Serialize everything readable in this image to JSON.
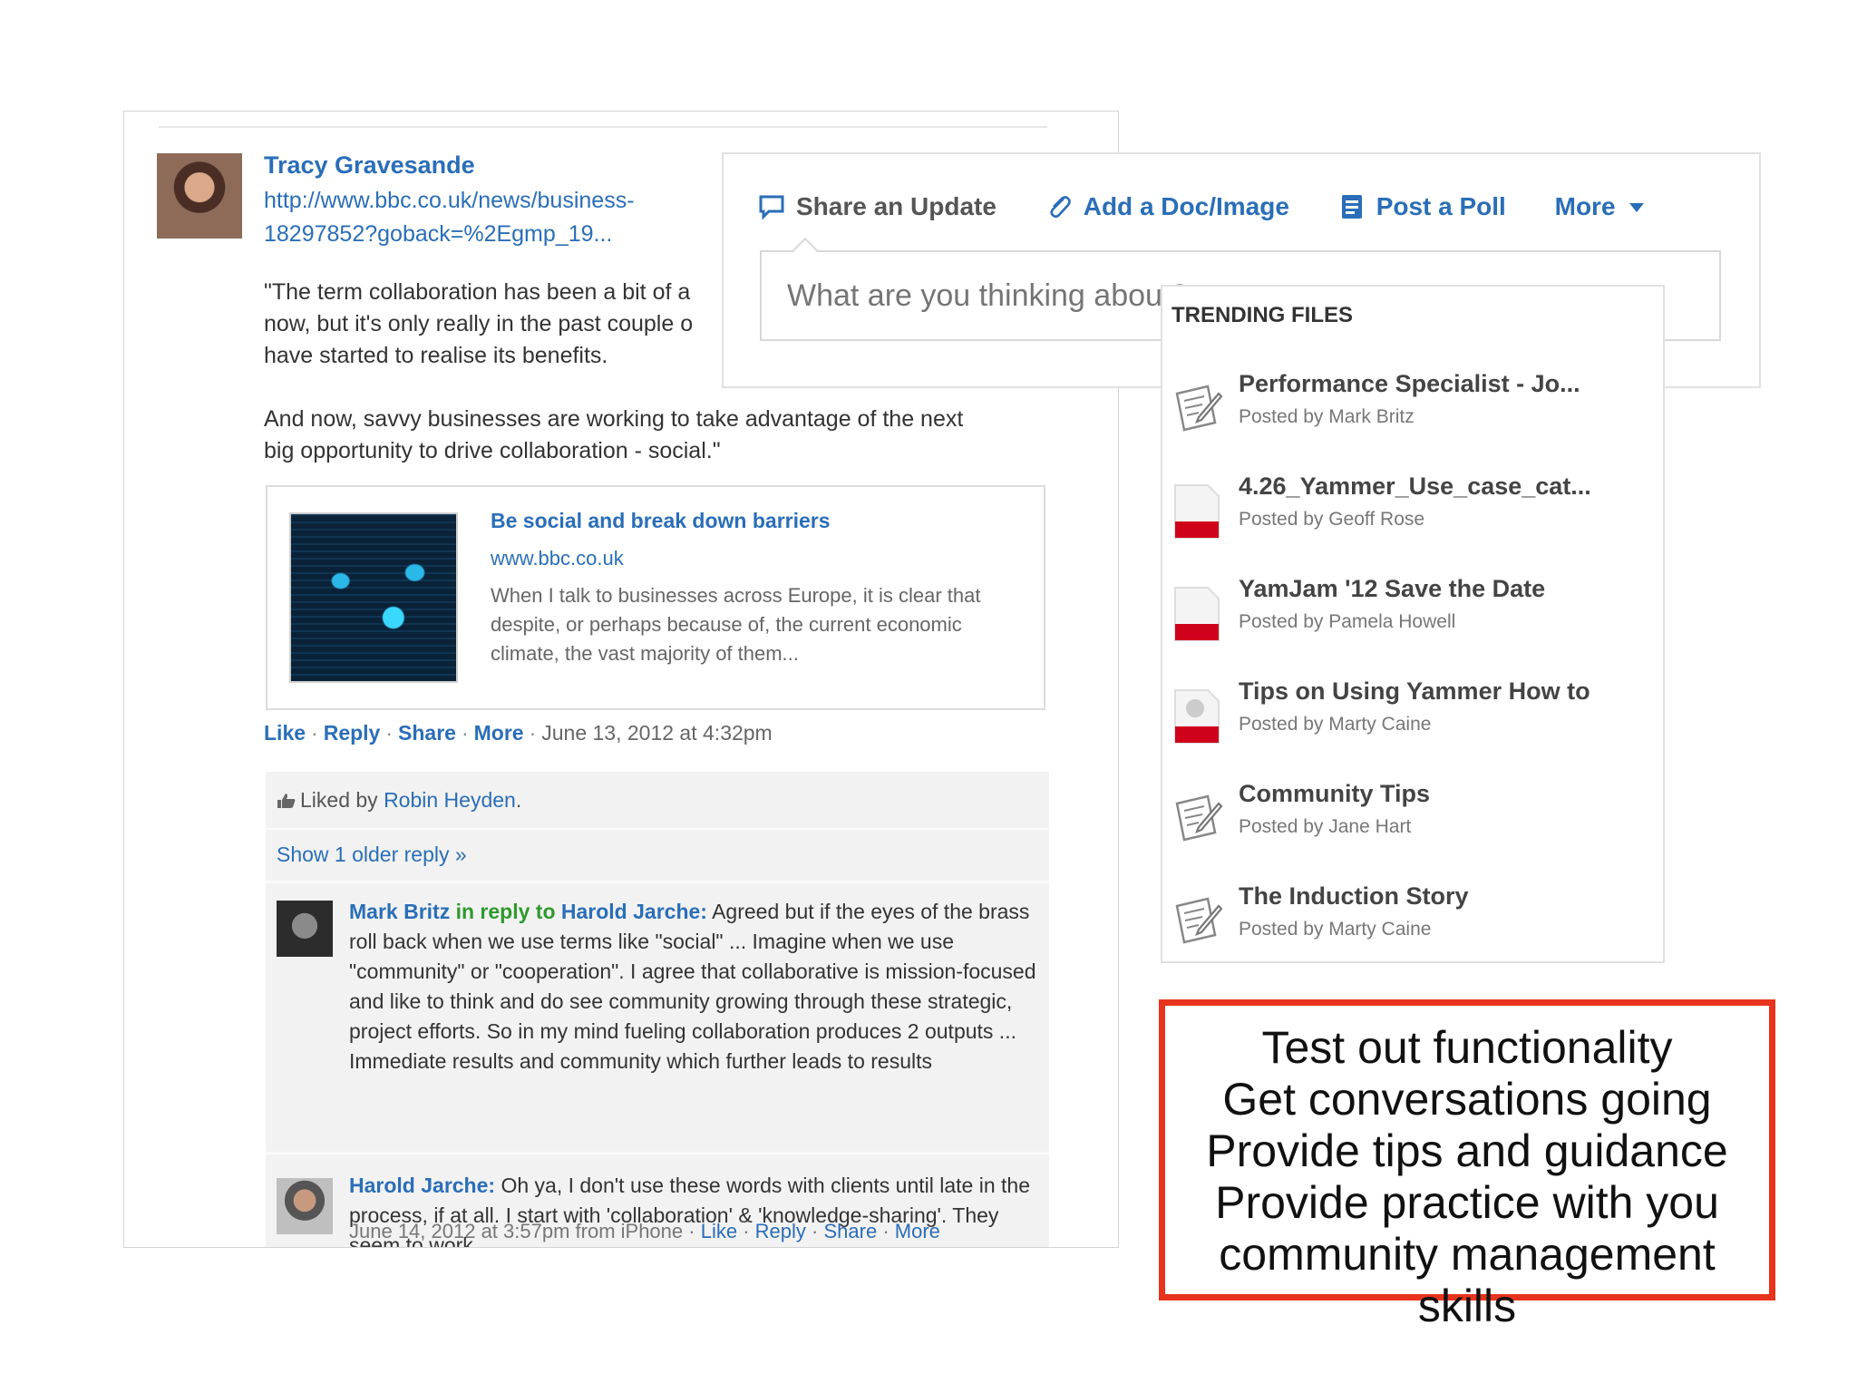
{
  "post": {
    "author": "Tracy Gravesande",
    "url_text": "http://www.bbc.co.uk/news/business-18297852?goback=%2Egmp_19...",
    "quote": "\"The term collaboration has been a bit of a\nnow, but it's only really in the past couple o\nhave started to realise its benefits.\n\nAnd now, savvy businesses are working to take advantage of the next\nbig opportunity to drive collaboration - social.\"",
    "link_card": {
      "title": "Be social and break down barriers",
      "domain": "www.bbc.co.uk",
      "description": "When I talk to businesses across Europe, it is clear that despite, or perhaps because of, the current economic climate, the vast majority of them..."
    },
    "actions": {
      "like": "Like",
      "reply": "Reply",
      "share": "Share",
      "more": "More",
      "separator": "·",
      "timestamp": "June 13, 2012 at 4:32pm"
    },
    "liked_by": {
      "prefix": "Liked by",
      "name": "Robin Heyden",
      "suffix": "."
    },
    "show_older": "Show 1 older reply »",
    "replies": [
      {
        "author": "Mark Britz",
        "in_reply_to": "in reply to",
        "target": "Harold Jarche",
        "text": "Agreed but if the eyes of the brass roll back when we use terms like \"social\" ... Imagine when we use \"community\" or \"cooperation\". I agree that collaborative is mission-focused and like to think and do see community growing through these strategic, project efforts. So in my mind fueling collaboration produces 2 outputs ... Immediate results and community which further leads to results",
        "meta_time": "June 14, 2012 at 3:57pm from iPhone",
        "like": "Like",
        "reply": "Reply",
        "share": "Share",
        "more": "More"
      },
      {
        "author": "Harold Jarche",
        "text": "Oh ya, I don't use these words with clients until late in the process, if at all. I start with 'collaboration' & 'knowledge-sharing'. They seem to work"
      }
    ]
  },
  "composer": {
    "tabs": [
      "Share an Update",
      "Add a Doc/Image",
      "Post a Poll",
      "More"
    ],
    "placeholder": "What are you thinking about?"
  },
  "trending": {
    "heading": "TRENDING FILES",
    "files": [
      {
        "name": "Performance Specialist - Jo...",
        "posted_by": "Posted by Mark Britz",
        "icon": "note-icon"
      },
      {
        "name": "4.26_Yammer_Use_case_cat...",
        "posted_by": "Posted by Geoff Rose",
        "icon": "pdf-icon"
      },
      {
        "name": "YamJam '12 Save the Date",
        "posted_by": "Posted by Pamela Howell",
        "icon": "pdf-icon"
      },
      {
        "name": "Tips on Using Yammer How to",
        "posted_by": "Posted by Marty Caine",
        "icon": "pdf-icon"
      },
      {
        "name": "Community Tips",
        "posted_by": "Posted by Jane Hart",
        "icon": "note-icon"
      },
      {
        "name": "The Induction Story",
        "posted_by": "Posted by Marty Caine",
        "icon": "note-icon"
      }
    ]
  },
  "note": {
    "lines": [
      "Test out functionality",
      "Get conversations going",
      "Provide tips and guidance",
      "Provide practice with you",
      "community management",
      "skills"
    ],
    "border_color": "#e8341c"
  },
  "colors": {
    "link": "#2a6eb8",
    "reply_green": "#2d9a2d",
    "pdf_red": "#d0021b"
  }
}
